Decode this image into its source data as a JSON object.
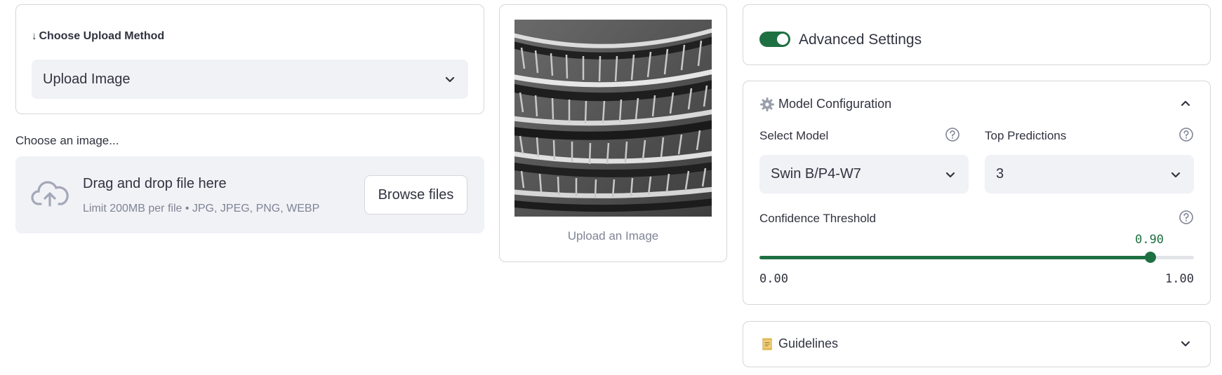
{
  "upload_method": {
    "label": "Choose Upload Method",
    "selected": "Upload Image"
  },
  "uploader": {
    "label": "Choose an image...",
    "dropzone_title": "Drag and drop file here",
    "dropzone_subtitle": "Limit 200MB per file • JPG, JPEG, PNG, WEBP",
    "browse_label": "Browse files"
  },
  "preview": {
    "caption": "Upload an Image"
  },
  "advanced": {
    "label": "Advanced Settings",
    "enabled": true
  },
  "model_config": {
    "title": "Model Configuration",
    "expanded": true,
    "select_model": {
      "label": "Select Model",
      "value": "Swin B/P4-W7"
    },
    "top_predictions": {
      "label": "Top Predictions",
      "value": "3"
    },
    "confidence": {
      "label": "Confidence Threshold",
      "value": "0.90",
      "min": "0.00",
      "max": "1.00",
      "fraction": 0.9
    }
  },
  "guidelines": {
    "title": "Guidelines",
    "expanded": false
  },
  "colors": {
    "accent": "#1e7042",
    "input_bg": "#f0f2f6",
    "muted_text": "#808495",
    "border": "#d6d6d9"
  }
}
